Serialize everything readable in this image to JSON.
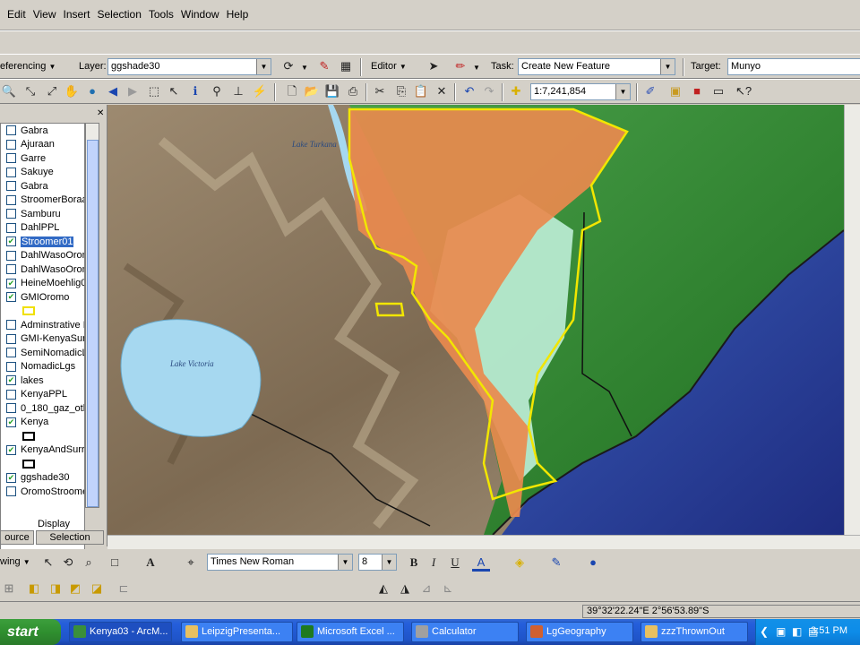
{
  "menu": [
    "Edit",
    "View",
    "Insert",
    "Selection",
    "Tools",
    "Window",
    "Help"
  ],
  "toolbar1": {
    "georef_label": "eferencing",
    "layer_label": "Layer:",
    "layer_value": "ggshade30",
    "editor_label": "Editor",
    "task_label": "Task:",
    "task_value": "Create New Feature",
    "target_label": "Target:",
    "target_value": "Munyo"
  },
  "toolbar2": {
    "scale_value": "1:7,241,854"
  },
  "toc": {
    "layers": [
      {
        "label": "Gabra",
        "checked": false
      },
      {
        "label": "Ajuraan",
        "checked": false
      },
      {
        "label": "Garre",
        "checked": false
      },
      {
        "label": "Sakuye",
        "checked": false
      },
      {
        "label": "Gabra",
        "checked": false
      },
      {
        "label": "StroomerBoraa",
        "checked": false
      },
      {
        "label": "Samburu",
        "checked": false
      },
      {
        "label": "DahlPPL",
        "checked": false
      },
      {
        "label": "Stroomer01",
        "checked": true
      },
      {
        "label": "DahlWasoOrom",
        "checked": false
      },
      {
        "label": "DahlWasoOrom",
        "checked": false
      },
      {
        "label": "HeineMoehlig01",
        "checked": true
      },
      {
        "label": "GMIOromo",
        "checked": true
      },
      {
        "label": "Adminstrative B",
        "checked": false
      },
      {
        "label": "GMI-KenyaSurr",
        "checked": false
      },
      {
        "label": "SemiNomadicLg",
        "checked": false
      },
      {
        "label": "NomadicLgs",
        "checked": false
      },
      {
        "label": "lakes",
        "checked": true
      },
      {
        "label": "KenyaPPL",
        "checked": false
      },
      {
        "label": "0_180_gaz_oth",
        "checked": false
      },
      {
        "label": "Kenya",
        "checked": true
      },
      {
        "label": "KenyaAndSurro",
        "checked": true
      },
      {
        "label": "ggshade30",
        "checked": true
      },
      {
        "label": "OromoStroome",
        "checked": false
      }
    ],
    "tabs": {
      "display": "Display",
      "source": "ource",
      "selection": "Selection"
    }
  },
  "map": {
    "lake_turkana": "Lake Turkana",
    "lake_victoria": "Lake Victoria"
  },
  "draw_toolbar": {
    "drawing_label": "wing",
    "font_value": "Times New Roman",
    "size_value": "8",
    "bold": "B",
    "italic": "I",
    "underline": "U",
    "font_color_glyph": "A"
  },
  "status": {
    "coords": "39°32'22.24\"E  2°56'53.89\"S"
  },
  "taskbar": {
    "start": "start",
    "tasks": [
      {
        "label": "Kenya03 - ArcM...",
        "color": "#3a8f3a"
      },
      {
        "label": "LeipzigPresenta...",
        "color": "#e8c060"
      },
      {
        "label": "Microsoft Excel ...",
        "color": "#1f7a1f"
      },
      {
        "label": "Calculator",
        "color": "#a0a0a0"
      },
      {
        "label": "LgGeography",
        "color": "#d06030"
      },
      {
        "label": "zzzThrownOut",
        "color": "#e8c060"
      }
    ],
    "clock": "3:51 PM"
  },
  "colors": {
    "lake": "#a6d8f0",
    "kenya_green": "#2f8a2f",
    "ocean": "#2a3e94",
    "oromo_orange": "#e98a4e",
    "boundary_yellow": "#f2e600",
    "mint": "#bfeed8"
  }
}
